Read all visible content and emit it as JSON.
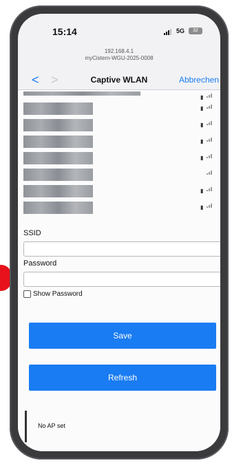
{
  "status_bar": {
    "time": "15:14",
    "network": "5G",
    "battery": "32"
  },
  "browser": {
    "address": "192.168.4.1",
    "host": "myCistern-WGU-2025-0008"
  },
  "nav": {
    "back": "<",
    "forward": ">",
    "title": "Captive WLAN",
    "cancel": "Abbrechen"
  },
  "networks": [
    {
      "locked": true
    },
    {
      "locked": true
    },
    {
      "locked": true
    },
    {
      "locked": true
    },
    {
      "locked": true
    },
    {
      "locked": false
    },
    {
      "locked": true
    },
    {
      "locked": true
    }
  ],
  "form": {
    "ssid_label": "SSID",
    "ssid_value": "",
    "password_label": "Password",
    "password_value": "",
    "show_password_label": "Show Password",
    "show_password_checked": false
  },
  "buttons": {
    "save": "Save",
    "refresh": "Refresh"
  },
  "status": {
    "message": "No AP set"
  },
  "icons": {
    "lock": "lock-icon",
    "wifi": "wifi-signal-icon",
    "back": "chevron-left-icon",
    "forward": "chevron-right-icon"
  },
  "colors": {
    "accent": "#1a7cf2",
    "marker": "#e8121c"
  }
}
